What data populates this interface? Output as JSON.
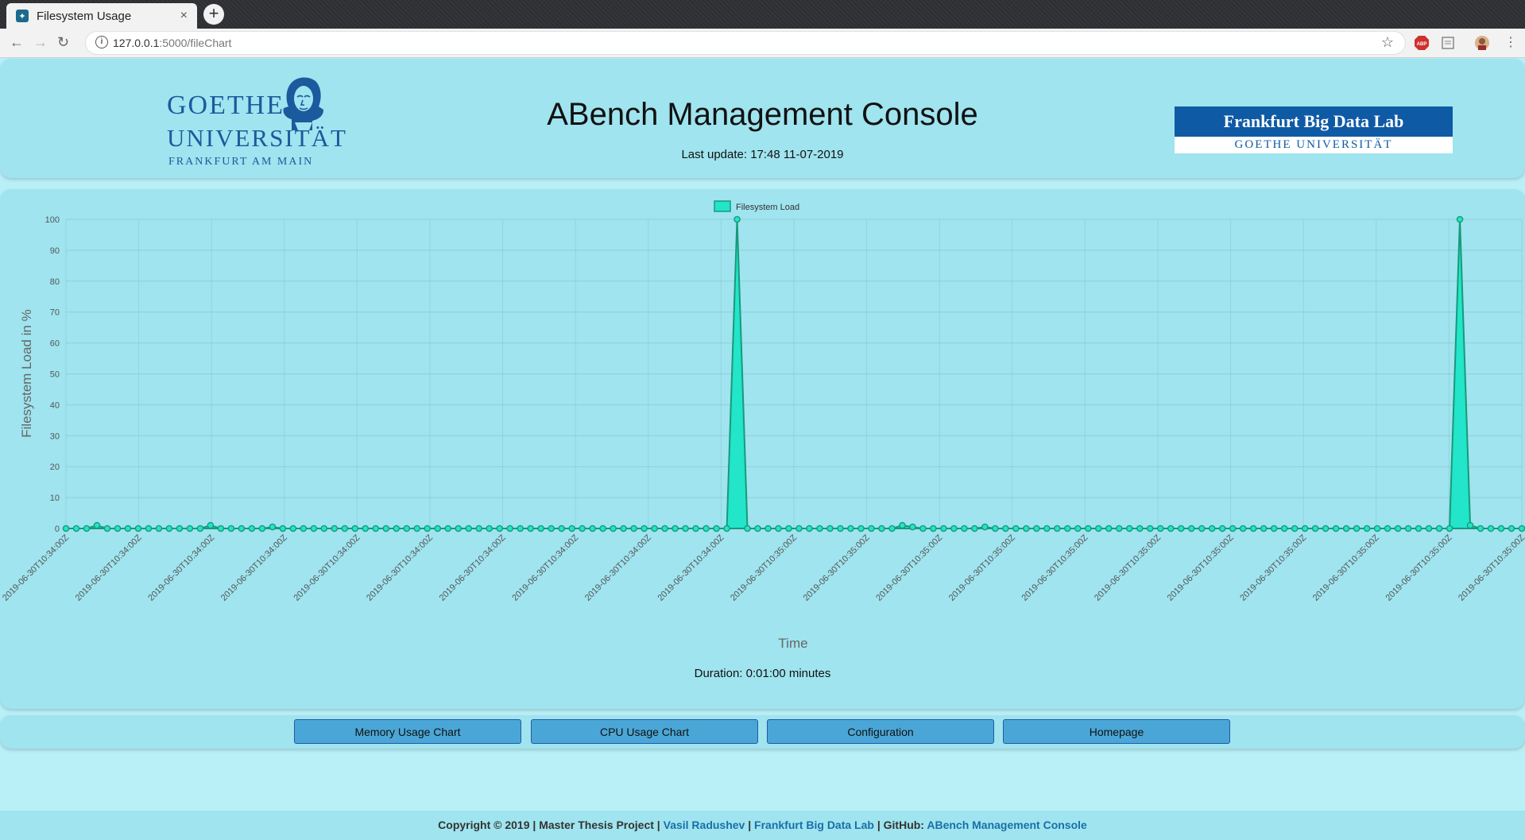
{
  "browser": {
    "tab_title": "Filesystem Usage",
    "tab_close": "×",
    "new_tab": "+",
    "url_host": "127.0.0.1",
    "url_rest": ":5000/fileChart",
    "ext_badge": "ABP"
  },
  "header": {
    "title": "ABench Management Console",
    "last_update": "Last update: 17:48 11-07-2019",
    "logo_left": {
      "line1": "GOETHE",
      "line2": "UNIVERSITÄT",
      "line3": "FRANKFURT AM MAIN"
    },
    "logo_right": {
      "line1": "Frankfurt Big Data Lab",
      "line2": "GOETHE UNIVERSITÄT"
    }
  },
  "colors": {
    "page_bg": "#b9f0f8",
    "panel_bg": "#9fe4ef",
    "series_fill": "#22e5c9",
    "series_stroke": "#189a7a",
    "button_bg": "#4aa6d6",
    "link": "#1a6fa8"
  },
  "chart_data": {
    "type": "area",
    "legend": [
      "Filesystem Load"
    ],
    "legend_position": "top",
    "xlabel": "Time",
    "ylabel": "Filesystem Load in %",
    "ylim": [
      0,
      100
    ],
    "yticks": [
      0,
      10,
      20,
      30,
      40,
      50,
      60,
      70,
      80,
      90,
      100
    ],
    "grid": true,
    "x_tick_labels": [
      "2019-06-30T10:34:00Z",
      "2019-06-30T10:34:00Z",
      "2019-06-30T10:34:00Z",
      "2019-06-30T10:34:00Z",
      "2019-06-30T10:34:00Z",
      "2019-06-30T10:34:00Z",
      "2019-06-30T10:34:00Z",
      "2019-06-30T10:34:00Z",
      "2019-06-30T10:34:00Z",
      "2019-06-30T10:34:00Z",
      "2019-06-30T10:35:00Z",
      "2019-06-30T10:35:00Z",
      "2019-06-30T10:35:00Z",
      "2019-06-30T10:35:00Z",
      "2019-06-30T10:35:00Z",
      "2019-06-30T10:35:00Z",
      "2019-06-30T10:35:00Z",
      "2019-06-30T10:35:00Z",
      "2019-06-30T10:35:00Z",
      "2019-06-30T10:35:00Z",
      "2019-06-30T10:35:00Z"
    ],
    "series": [
      {
        "name": "Filesystem Load",
        "values": [
          0,
          0,
          0,
          1,
          0,
          0,
          0,
          0,
          0,
          0,
          0,
          0,
          0,
          0,
          1,
          0,
          0,
          0,
          0,
          0,
          0.5,
          0,
          0,
          0,
          0,
          0,
          0,
          0,
          0,
          0,
          0,
          0,
          0,
          0,
          0,
          0,
          0,
          0,
          0,
          0,
          0,
          0,
          0,
          0,
          0,
          0,
          0,
          0,
          0,
          0,
          0,
          0,
          0,
          0,
          0,
          0,
          0,
          0,
          0,
          0,
          0,
          0,
          0,
          0,
          0,
          100,
          0,
          0,
          0,
          0,
          0,
          0,
          0,
          0,
          0,
          0,
          0,
          0,
          0,
          0,
          0,
          1,
          0.5,
          0,
          0,
          0,
          0,
          0,
          0,
          0.5,
          0,
          0,
          0,
          0,
          0,
          0,
          0,
          0,
          0,
          0,
          0,
          0,
          0,
          0,
          0,
          0,
          0,
          0,
          0,
          0,
          0,
          0,
          0,
          0,
          0,
          0,
          0,
          0,
          0,
          0,
          0,
          0,
          0,
          0,
          0,
          0,
          0,
          0,
          0,
          0,
          0,
          0,
          0,
          0,
          0,
          100,
          1,
          0,
          0,
          0,
          0,
          0
        ]
      }
    ]
  },
  "duration": "Duration: 0:01:00 minutes",
  "buttons": {
    "memory": "Memory Usage Chart",
    "cpu": "CPU Usage Chart",
    "config": "Configuration",
    "home": "Homepage"
  },
  "footer": {
    "copyright": "Copyright © 2019 | Master Thesis Project | ",
    "author": "Vasil Radushev",
    "sep1": " | ",
    "lab": "Frankfurt Big Data Lab",
    "github_label": " | GitHub: ",
    "github_link": "ABench Management Console"
  }
}
